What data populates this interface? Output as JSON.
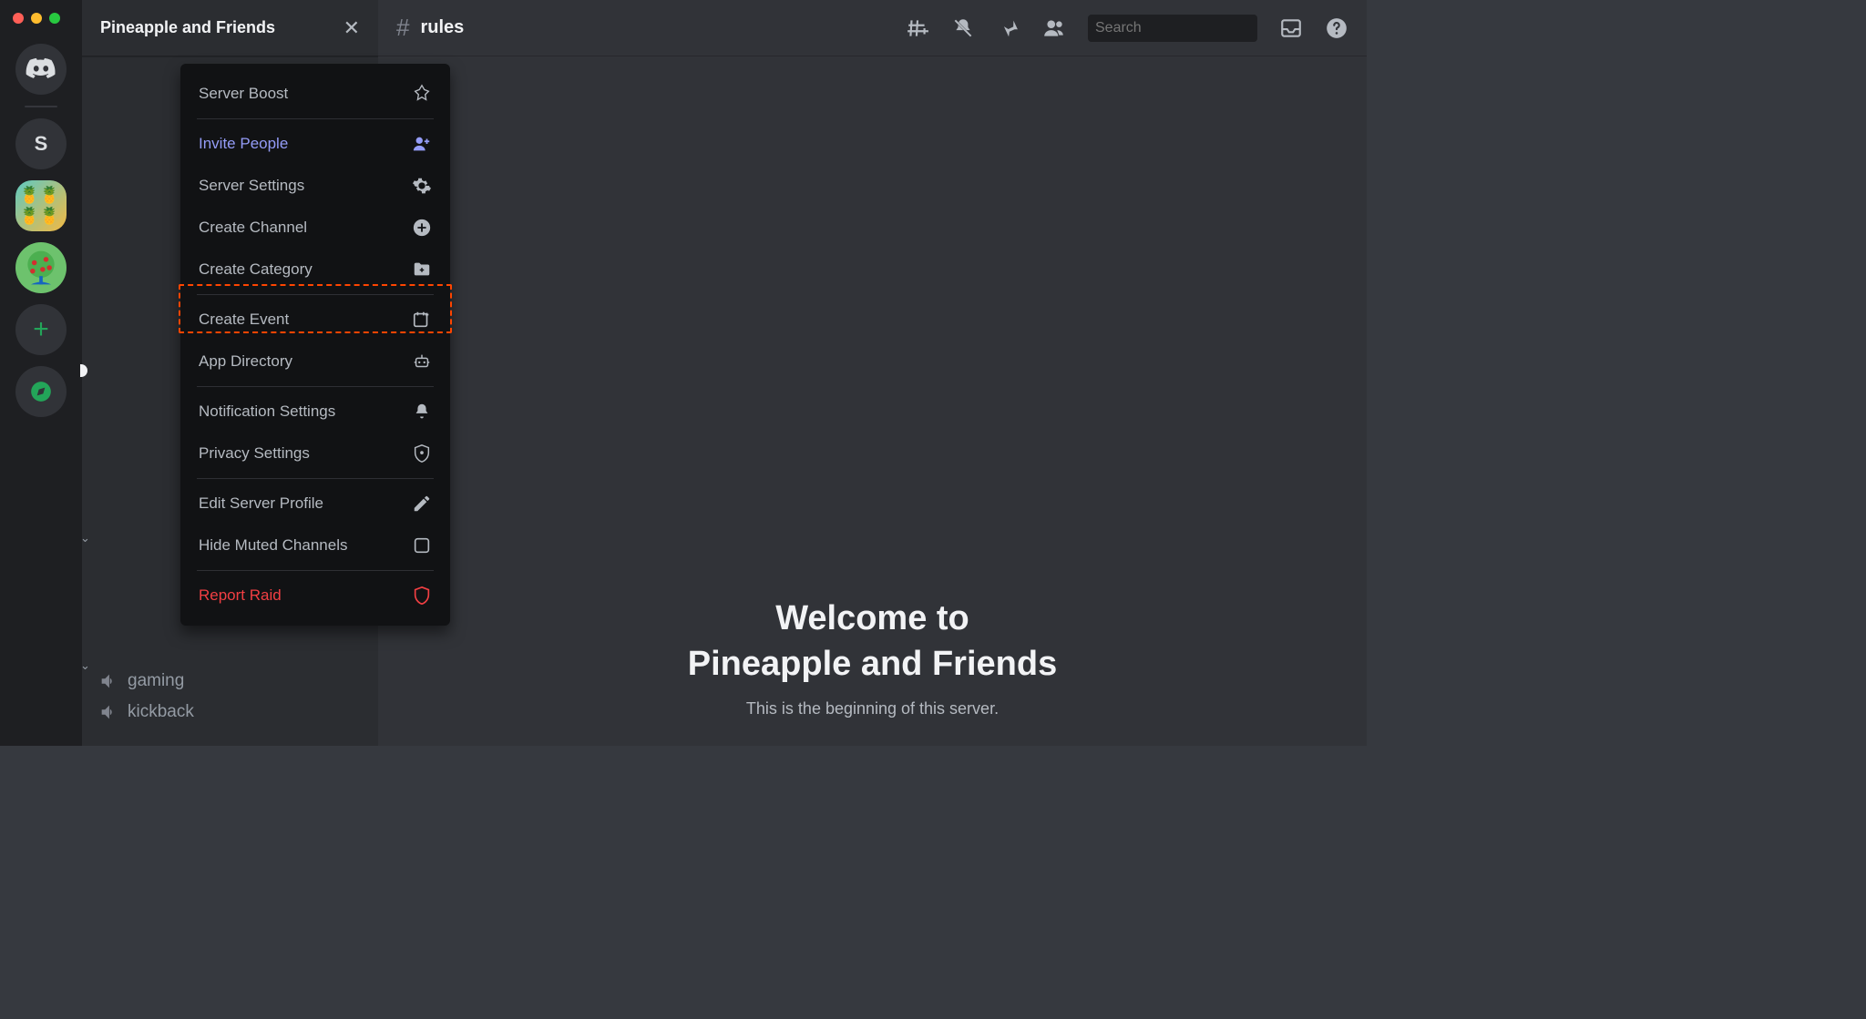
{
  "server": {
    "name": "Pineapple and Friends",
    "letter": "S"
  },
  "channel": {
    "name": "rules"
  },
  "search": {
    "placeholder": "Search"
  },
  "dropdown": {
    "boost": "Server Boost",
    "invite": "Invite People",
    "settings": "Server Settings",
    "create_channel": "Create Channel",
    "create_category": "Create Category",
    "create_event": "Create Event",
    "app_directory": "App Directory",
    "notif": "Notification Settings",
    "privacy": "Privacy Settings",
    "edit_profile": "Edit Server Profile",
    "hide_muted": "Hide Muted Channels",
    "report_raid": "Report Raid"
  },
  "voice_channels": [
    "gaming",
    "kickback"
  ],
  "welcome": {
    "line1": "Welcome to",
    "line2": "Pineapple and Friends",
    "sub": "This is the beginning of this server."
  }
}
